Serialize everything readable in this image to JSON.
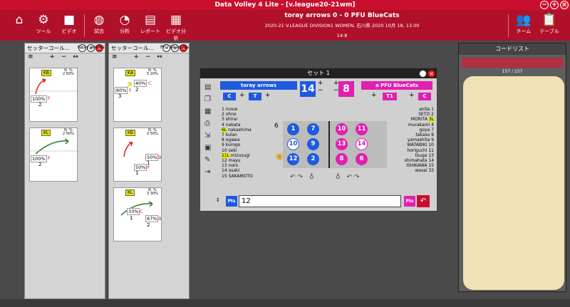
{
  "app": {
    "title": "Data Volley 4 Lite - [v.league20-21wm]",
    "colors": {
      "brand": "#c8102e",
      "home": "#1e5adc",
      "away": "#e020b0",
      "tag": "#e6e600"
    }
  },
  "toolbar": {
    "home_icon": "home-icon",
    "tools_label": "ツール",
    "video_label": "ビデオ",
    "match_label": "試合",
    "analysis_label": "分析",
    "report_label": "レポート",
    "video_analysis_label": "ビデオ分析",
    "team_label": "チーム",
    "table_label": "テーブル"
  },
  "match": {
    "line1": "toray arrows  0 - 0  PFU BlueCats",
    "line2": "2020-21 V.LEAGUE DIVISION1 WOMEN, 石川県 2020 10月 18, 13.00",
    "line3": "14-8"
  },
  "setter_panel_1": {
    "title": "セッターコール...",
    "team": "toray arrows",
    "cards": [
      {
        "tag": "KB",
        "n_label": "N",
        "n": "2",
        "pct_label": "%",
        "pct": "50%",
        "big_pct": "100%",
        "big_letter": "F",
        "count": "2"
      },
      {
        "tag": "KL",
        "n_label": "N",
        "n": "2",
        "pct_label": "%",
        "pct": "50%",
        "big_pct": "100%",
        "big_letter": "F",
        "count": "2"
      }
    ]
  },
  "setter_panel_2": {
    "title": "セッターコール...",
    "team": "PFU BlueCats",
    "cards": [
      {
        "tag": "KA",
        "n_label": "N",
        "n": "5",
        "pct_label": "%",
        "pct": "20%",
        "pcts": [
          {
            "v": "40%",
            "l": "C"
          },
          {
            "v": "60%",
            "l": "F"
          }
        ],
        "counts": [
          "2",
          "3"
        ]
      },
      {
        "tag": "KB",
        "n_label": "N",
        "n": "2",
        "pct_label": "%",
        "pct": "50%",
        "pcts": [
          {
            "v": "50%",
            "l": "B"
          },
          {
            "v": "50%",
            "l": "P"
          }
        ],
        "counts": [
          "1",
          "1"
        ]
      },
      {
        "tag": "KL",
        "n_label": "N",
        "n": "3",
        "pct_label": "%",
        "pct": "30%",
        "pcts": [
          {
            "v": "33%",
            "l": "C"
          },
          {
            "v": "67%",
            "l": "B"
          }
        ],
        "counts": [
          "1",
          "2"
        ]
      }
    ]
  },
  "set_dialog": {
    "title": "セット 1",
    "home_team": "toray arrows",
    "away_team": "a PFU BlueCats",
    "home_score": "14",
    "away_score": "8",
    "home_tags": [
      "C",
      "T"
    ],
    "away_tags": [
      "T1",
      "C"
    ],
    "home_rotation": "6",
    "away_rotation": "3",
    "home_roster": [
      [
        "1",
        "inoue"
      ],
      [
        "2",
        "ohno"
      ],
      [
        "3",
        "shirai"
      ],
      [
        "4",
        "nakata"
      ],
      [
        "6L",
        "nakashima"
      ],
      [
        "7",
        "kulan"
      ],
      [
        "8",
        "ogawa"
      ],
      [
        "9",
        "kurogo"
      ],
      [
        "10",
        "seki"
      ],
      [
        "11L",
        "mizusugi"
      ],
      [
        "12",
        "mayu"
      ],
      [
        "13",
        "noro"
      ],
      [
        "14",
        "osaki"
      ],
      [
        "15",
        "SAKAMOTO"
      ]
    ],
    "away_roster": [
      [
        "anita",
        "1"
      ],
      [
        "SETO",
        "2"
      ],
      [
        "MORITA",
        "3L"
      ],
      [
        "murakami",
        "4"
      ],
      [
        "goya",
        "7"
      ],
      [
        "takaso",
        "8"
      ],
      [
        "yamashita",
        "9"
      ],
      [
        "WATABIKI",
        "10"
      ],
      [
        "horiguchi",
        "11"
      ],
      [
        "tsuga",
        "13"
      ],
      [
        "shimahata",
        "14"
      ],
      [
        "ISHIKAWA",
        "15"
      ],
      [
        "wasai",
        "33"
      ]
    ],
    "home_court": [
      "1",
      "7",
      "10",
      "9",
      "12",
      "2"
    ],
    "away_court": [
      "10",
      "11",
      "13",
      "14",
      "8",
      "6"
    ],
    "code_input": "12",
    "pts_label": "Pts"
  },
  "code_list": {
    "title": "コードリスト",
    "count": "157 / 157"
  }
}
